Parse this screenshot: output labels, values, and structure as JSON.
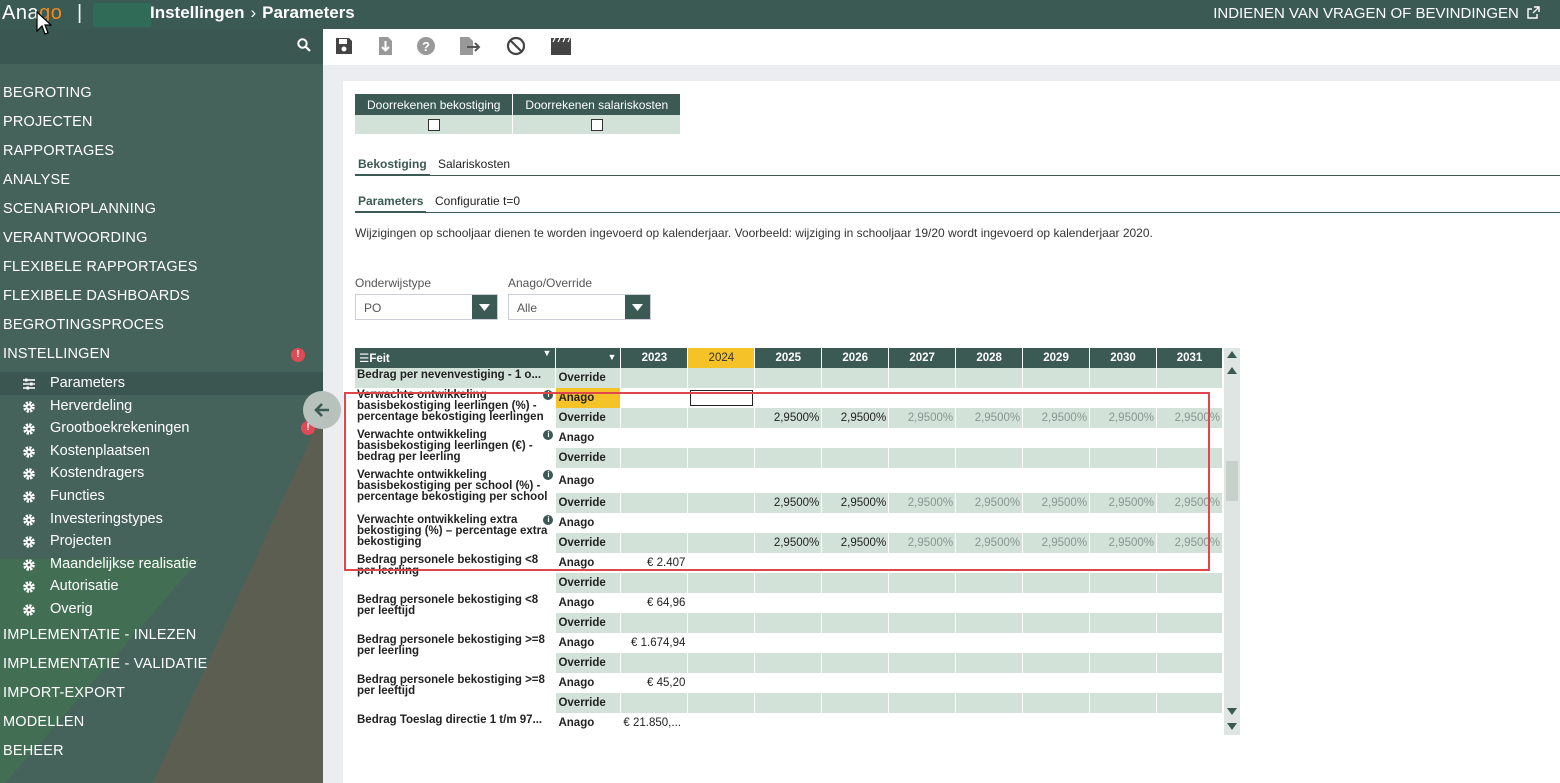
{
  "topbar": {
    "logo_main": "Ana",
    "logo_accent": "go",
    "logo_sep": "|",
    "crumb1": "Instellingen",
    "crumb_sep": "›",
    "crumb2": "Parameters",
    "feedback": "INDIENEN VAN VRAGEN OF BEVINDINGEN",
    "feedback_icon": "external-link-icon"
  },
  "sidebar": {
    "nav_top": [
      "BEGROTING",
      "PROJECTEN",
      "RAPPORTAGES",
      "ANALYSE",
      "SCENARIOPLANNING",
      "VERANTWOORDING",
      "FLEXIBELE RAPPORTAGES",
      "FLEXIBELE DASHBOARDS",
      "BEGROTINGSPROCES",
      "INSTELLINGEN"
    ],
    "badge": "!",
    "sub_items": [
      "Parameters",
      "Herverdeling",
      "Grootboekrekeningen",
      "Kostenplaatsen",
      "Kostendragers",
      "Functies",
      "Investeringstypes",
      "Projecten",
      "Maandelijkse realisatie",
      "Autorisatie",
      "Overig"
    ],
    "nav_bottom": [
      "IMPLEMENTATIE - INLEZEN",
      "IMPLEMENTATIE - VALIDATIE",
      "IMPORT-EXPORT",
      "MODELLEN",
      "BEHEER"
    ]
  },
  "toggles": {
    "col1": "Doorrekenen bekostiging",
    "col2": "Doorrekenen salariskosten"
  },
  "tabs1": {
    "a": "Bekostiging",
    "b": "Salariskosten"
  },
  "tabs2": {
    "a": "Parameters",
    "b": "Configuratie t=0"
  },
  "note": "Wijzigingen op schooljaar dienen te worden ingevoerd op kalenderjaar. Voorbeeld: wijziging in schooljaar 19/20 wordt ingevoerd op kalenderjaar 2020.",
  "filters": {
    "onderwijstype_label": "Onderwijstype",
    "onderwijstype_value": "PO",
    "override_label": "Anago/Override",
    "override_value": "Alle"
  },
  "grid": {
    "feit_header": "Feit",
    "years": [
      "2023",
      "2024",
      "2025",
      "2026",
      "2027",
      "2028",
      "2029",
      "2030",
      "2031"
    ],
    "r0_name": "Bedrag per nevenvestiging - 1 o...",
    "r1_name": "Verwachte ontwikkeling basisbekostiging leerlingen (%) - percentage bekostiging leerlingen",
    "r2_name": "Verwachte ontwikkeling basisbekostiging leerlingen (€) - bedrag per leerling",
    "r3_name": "Verwachte ontwikkeling basisbekostiging per school (%) - percentage bekostiging per school",
    "r4_name": "Verwachte ontwikkeling extra bekostiging (%) – percentage extra bekostiging",
    "r5_name": "Bedrag personele bekostiging <8 per leerling",
    "r6_name": "Bedrag personele bekostiging <8 per leeftijd",
    "r7_name": "Bedrag personele bekostiging >=8 per leerling",
    "r8_name": "Bedrag personele bekostiging >=8 per leeftijd",
    "r9_name": "Bedrag Toeslag directie 1 t/m 97...",
    "anago": "Anago",
    "override": "Override",
    "pct": "2,9500%",
    "v5": "€ 2.407",
    "v6": "€ 64,96",
    "v7": "€ 1.674,94",
    "v8": "€ 45,20",
    "v9": "€ 21.850,..."
  }
}
